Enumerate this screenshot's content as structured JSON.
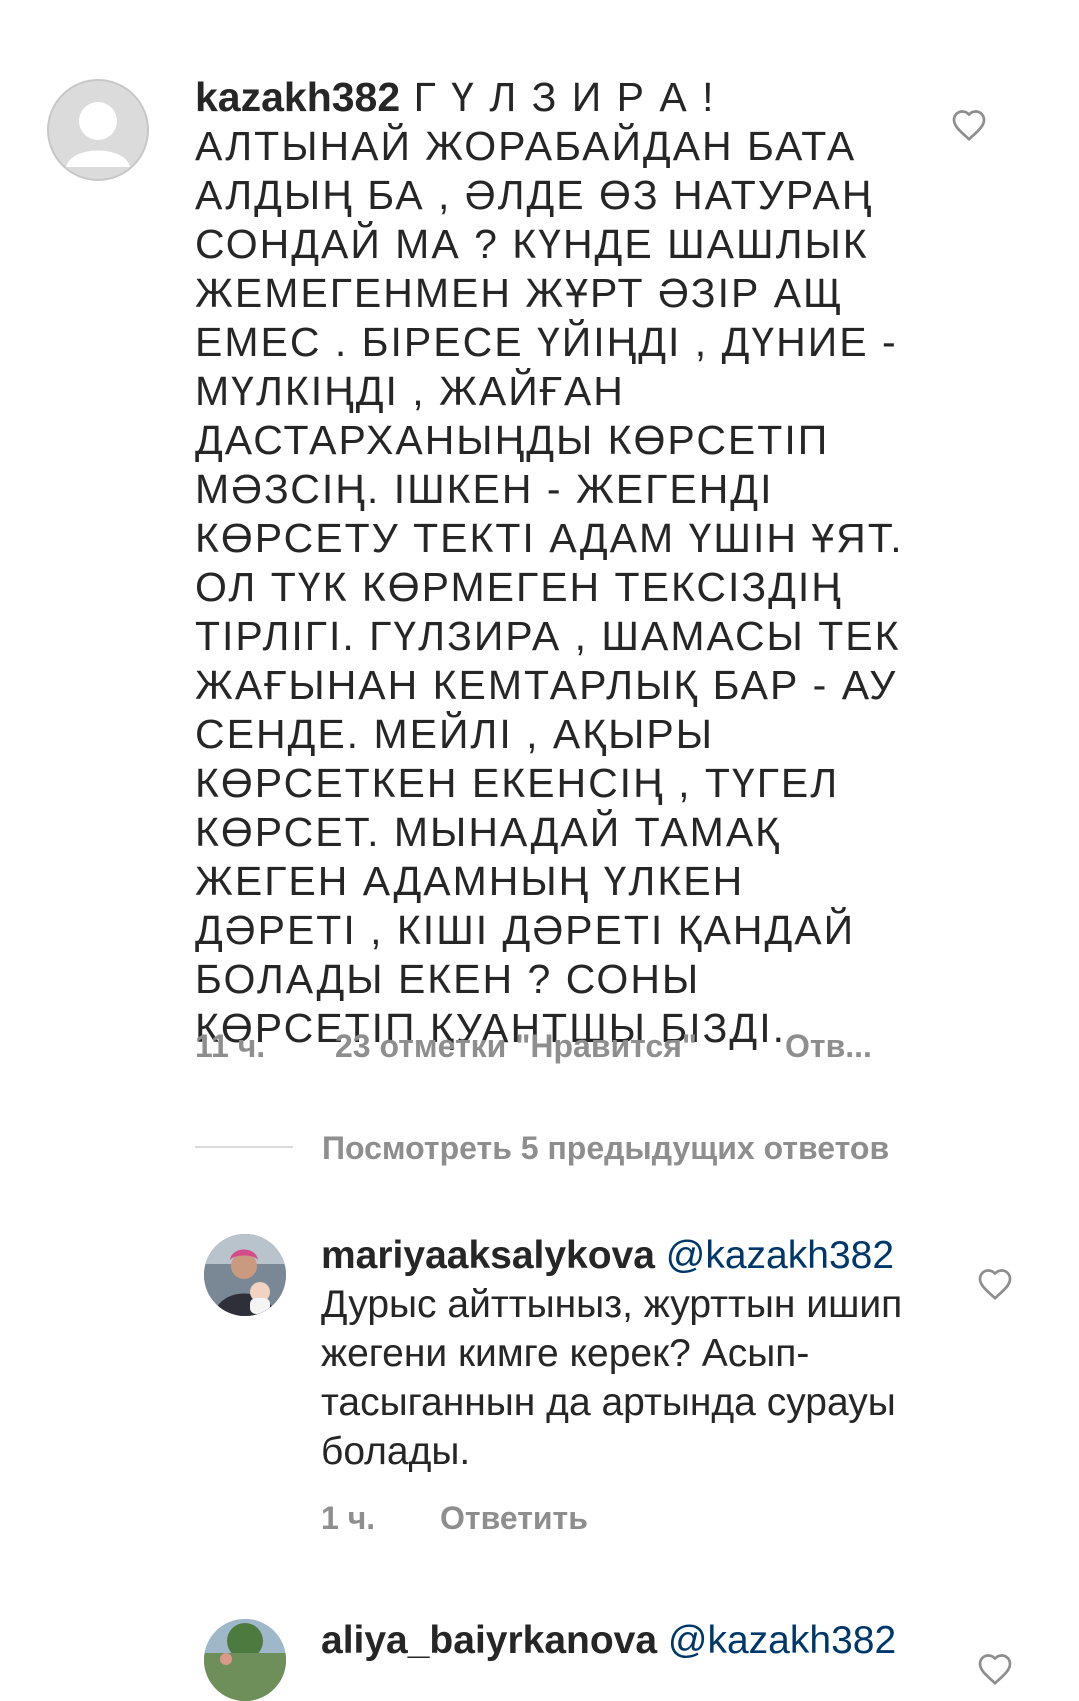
{
  "main_comment": {
    "username": "kazakh382",
    "text": " Г Ү Л З И Р А ! АЛТЫНАЙ ЖОРАБАЙДАН БАТА АЛДЫҢ БА , ӘЛДЕ ӨЗ НАТУРАҢ СОНДАЙ МА ? КҮНДЕ ШАШЛЫК ЖЕМЕГЕНМЕН ЖҰРТ ӘЗІР АЩ ЕМЕС . БІРЕСЕ ҮЙІҢДІ , ДҮНИЕ - МҮЛКІҢДІ , ЖАЙҒАН ДАСТАРХАНЫҢДЫ КӨРСЕТІП МӘЗСІҢ. ІШКЕН - ЖЕГЕНДІ КӨРСЕТУ ТЕКТІ АДАМ ҮШІН ҰЯТ. ОЛ ТҮК КӨРМЕГЕН ТЕКСІЗДІҢ ТІРЛІГІ. ГҮЛЗИРА , ШАМАСЫ ТЕК ЖАҒЫНАН КЕМТАРЛЫҚ БАР - АУ СЕНДЕ. МЕЙЛІ , АҚЫРЫ КӨРСЕТКЕН ЕКЕНСІҢ , ТҮГЕЛ КӨРСЕТ. МЫНАДАЙ ТАМАҚ ЖЕГЕН АДАМНЫҢ ҮЛКЕН ДӘРЕТІ , КІШІ ДӘРЕТІ ҚАНДАЙ БОЛАДЫ ЕКЕН ? СОНЫ КӨРСЕТІП ҚУАНТШЫ БІЗДІ.",
    "time": "11 ч.",
    "likes": "23 отметки \"Нравится\"",
    "reply": "Отв..."
  },
  "view_replies": "Посмотреть 5 предыдущих ответов",
  "reply_1": {
    "username": "mariyaaksalykova",
    "mention": "@kazakh382",
    "text": "Дурыс айттыныз, журттын ишип жегени кимге керек? Асып- тасыганнын да артында сурауы болады.",
    "time": "1 ч.",
    "reply": "Ответить"
  },
  "reply_2": {
    "username": "aliya_baiyrkanova",
    "mention": "@kazakh382"
  },
  "icons": {
    "like": "heart-outline-icon",
    "default_avatar": "default-user-icon"
  },
  "colors": {
    "text": "#262626",
    "secondary": "#8e8e8e",
    "mention": "#00376b",
    "divider": "#dbdbdb"
  }
}
